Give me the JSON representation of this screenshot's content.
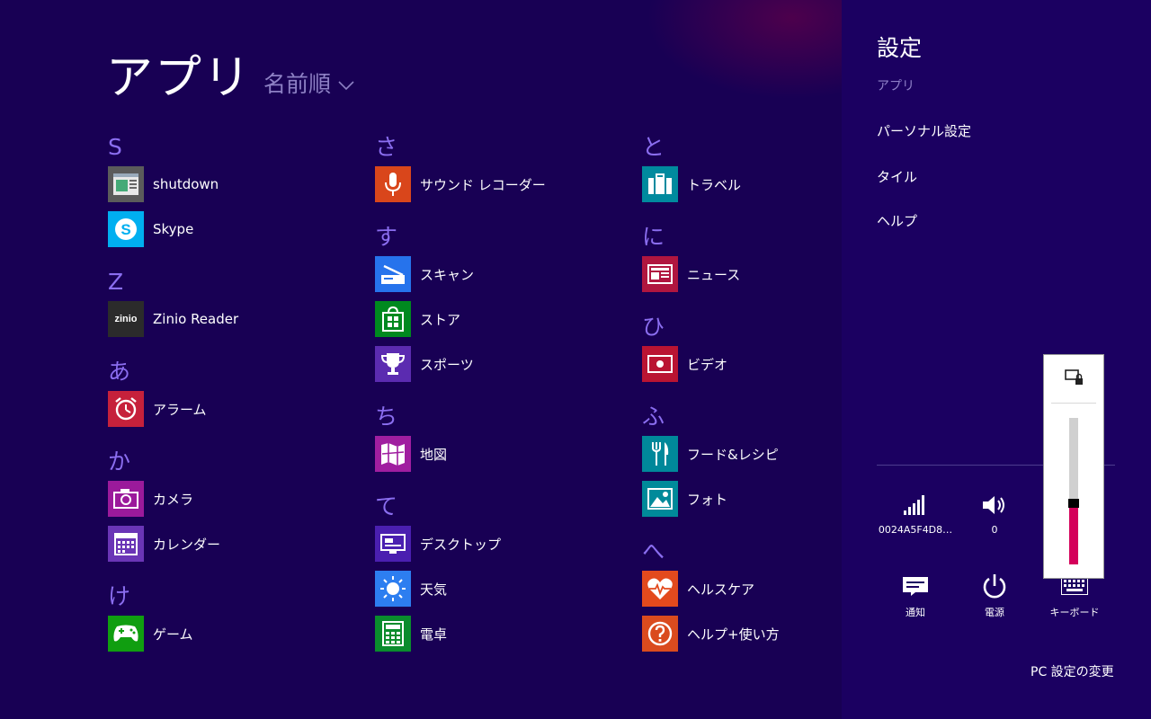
{
  "apps": {
    "title": "アプリ",
    "sort_label": "名前順",
    "columns": [
      {
        "groups": [
          {
            "header": "S",
            "items": [
              {
                "label": "shutdown",
                "icon": "shutdown-app-icon",
                "color": "#5b5b5b"
              },
              {
                "label": "Skype",
                "icon": "skype-icon",
                "color": "#00aff0"
              }
            ]
          },
          {
            "header": "Z",
            "items": [
              {
                "label": "Zinio Reader",
                "icon": "zinio-icon",
                "color": "#2b2b2b",
                "icon_text": "zinio"
              }
            ]
          },
          {
            "header": "あ",
            "items": [
              {
                "label": "アラーム",
                "icon": "alarm-icon",
                "color": "#c6213b"
              }
            ]
          },
          {
            "header": "か",
            "items": [
              {
                "label": "カメラ",
                "icon": "camera-icon",
                "color": "#9b1a9b"
              },
              {
                "label": "カレンダー",
                "icon": "calendar-icon",
                "color": "#6a35b6"
              }
            ]
          },
          {
            "header": "け",
            "items": [
              {
                "label": "ゲーム",
                "icon": "game-controller-icon",
                "color": "#109e10"
              }
            ]
          }
        ]
      },
      {
        "groups": [
          {
            "header": "さ",
            "items": [
              {
                "label": "サウンド レコーダー",
                "icon": "microphone-icon",
                "color": "#d9461b"
              }
            ]
          },
          {
            "header": "す",
            "items": [
              {
                "label": "スキャン",
                "icon": "scanner-icon",
                "color": "#2673ec"
              },
              {
                "label": "ストア",
                "icon": "store-icon",
                "color": "#00891f"
              },
              {
                "label": "スポーツ",
                "icon": "trophy-icon",
                "color": "#5b2bb0"
              }
            ]
          },
          {
            "header": "ち",
            "items": [
              {
                "label": "地図",
                "icon": "map-icon",
                "color": "#a01ea0"
              }
            ]
          },
          {
            "header": "て",
            "items": [
              {
                "label": "デスクトップ",
                "icon": "desktop-icon",
                "color": "#4a1fb0"
              },
              {
                "label": "天気",
                "icon": "sun-icon",
                "color": "#2d7ef0"
              },
              {
                "label": "電卓",
                "icon": "calculator-icon",
                "color": "#0a8c2d"
              }
            ]
          }
        ]
      },
      {
        "groups": [
          {
            "header": "と",
            "items": [
              {
                "label": "トラベル",
                "icon": "suitcase-icon",
                "color": "#008a9e"
              }
            ]
          },
          {
            "header": "に",
            "items": [
              {
                "label": "ニュース",
                "icon": "newspaper-icon",
                "color": "#b0163f"
              }
            ]
          },
          {
            "header": "ひ",
            "items": [
              {
                "label": "ビデオ",
                "icon": "video-icon",
                "color": "#ba1432"
              }
            ]
          },
          {
            "header": "ふ",
            "items": [
              {
                "label": "フード&レシピ",
                "icon": "fork-knife-icon",
                "color": "#00889a"
              },
              {
                "label": "フォト",
                "icon": "photo-icon",
                "color": "#008a9a"
              }
            ]
          },
          {
            "header": "へ",
            "items": [
              {
                "label": "ヘルスケア",
                "icon": "heart-pulse-icon",
                "color": "#e34a1d"
              },
              {
                "label": "ヘルプ+使い方",
                "icon": "help-icon",
                "color": "#da4b1e"
              }
            ]
          }
        ]
      }
    ]
  },
  "charm": {
    "title": "設定",
    "subtitle": "アプリ",
    "items": [
      "パーソナル設定",
      "タイル",
      "ヘルプ"
    ],
    "quick": {
      "network": {
        "label": "0024A5F4D8…"
      },
      "volume": {
        "label": "0"
      },
      "notifications": {
        "label": "通知"
      },
      "power": {
        "label": "電源"
      },
      "keyboard": {
        "label": "キーボード"
      }
    },
    "pc_settings": "PC 設定の変更"
  },
  "brightness": {
    "level": 0.4
  }
}
